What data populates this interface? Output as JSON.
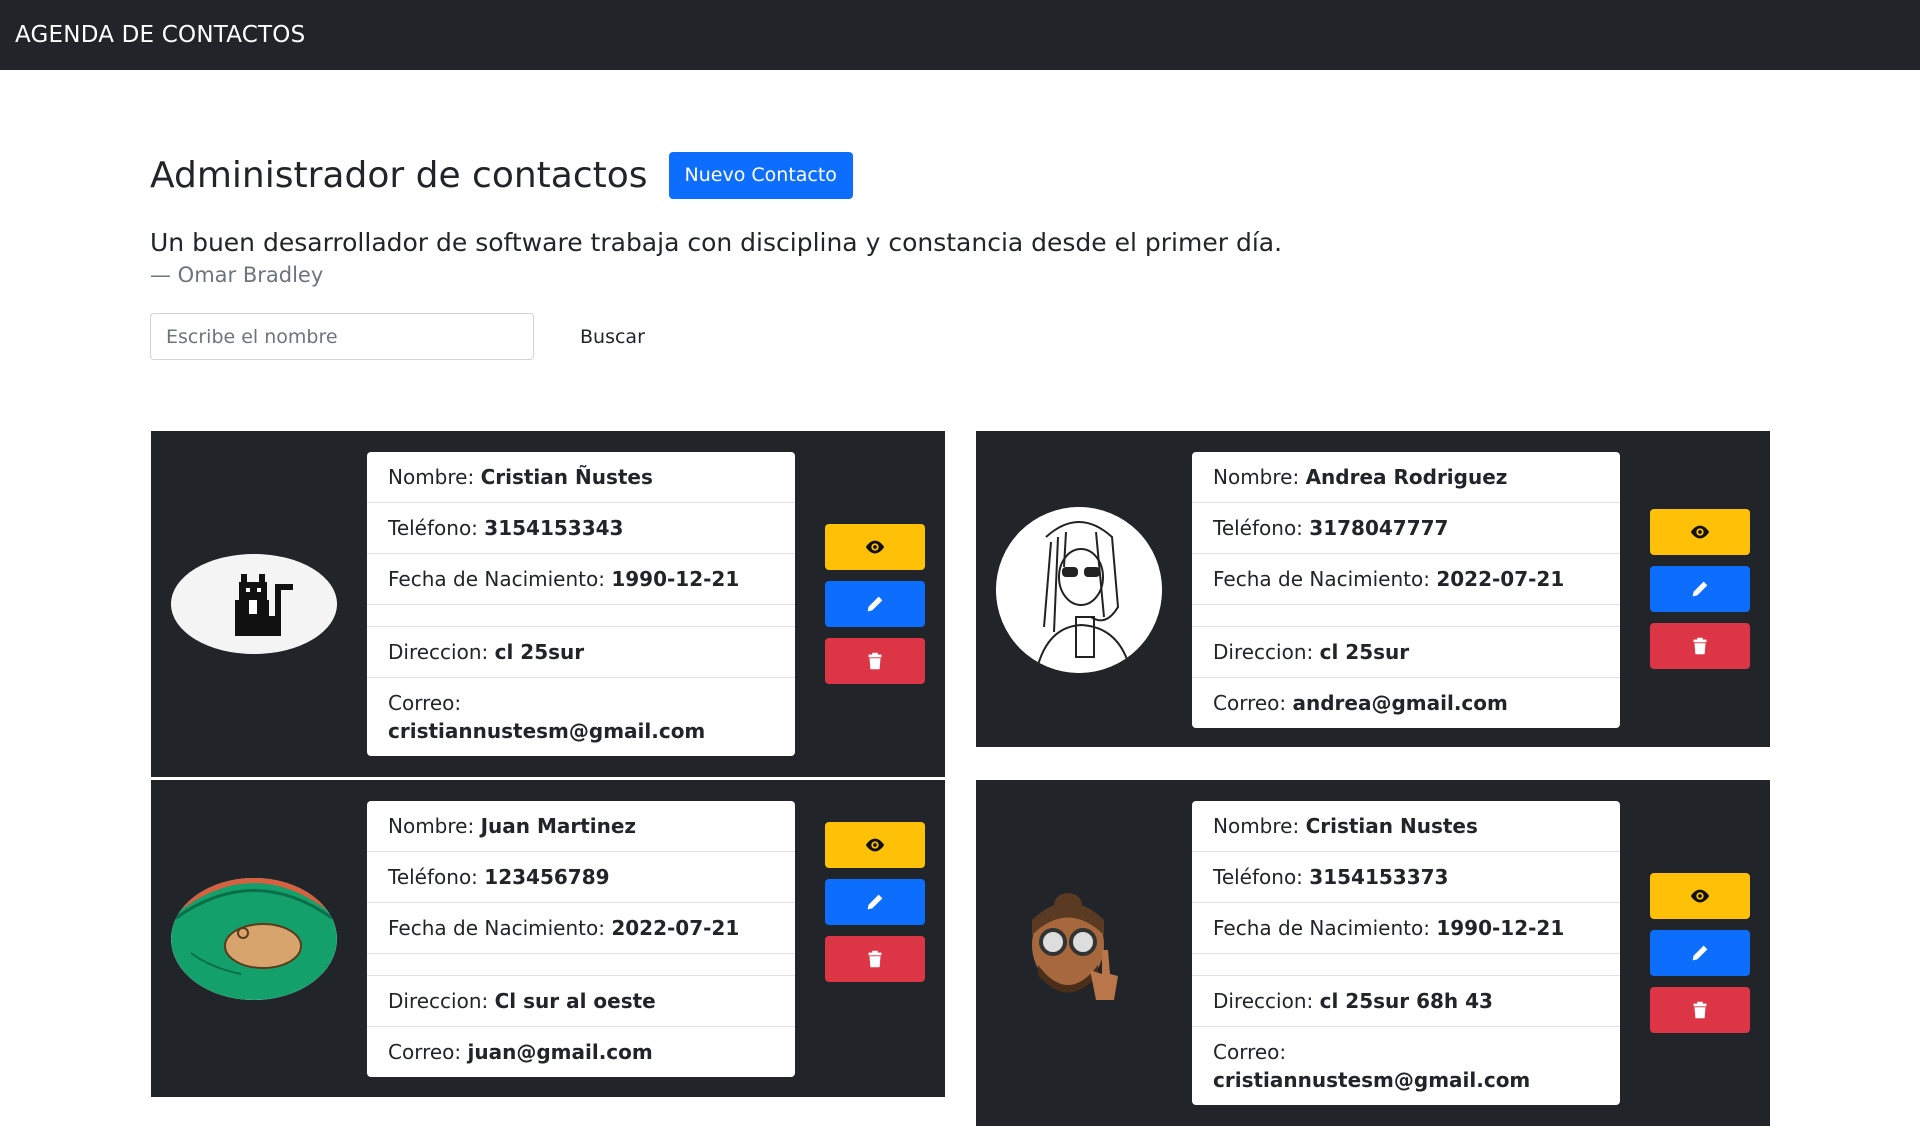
{
  "navbar": {
    "brand": "AGENDA DE CONTACTOS"
  },
  "header": {
    "title": "Administrador de contactos",
    "new_button": "Nuevo Contacto"
  },
  "quote": {
    "text": "Un buen desarrollador de software trabaja con disciplina y constancia desde el primer día.",
    "author": "— Omar Bradley"
  },
  "search": {
    "placeholder": "Escribe el nombre",
    "value": "",
    "button": "Buscar"
  },
  "labels": {
    "name": "Nombre:",
    "phone": "Teléfono:",
    "birth": "Fecha de Nacimiento:",
    "address": "Direccion:",
    "email": "Correo:"
  },
  "contacts": [
    {
      "name": "Cristian Ñustes",
      "phone": "3154153343",
      "birth": "1990-12-21",
      "address": "cl 25sur",
      "email": "cristiannustesm@gmail.com",
      "avatar": "cat-icon"
    },
    {
      "name": "Andrea Rodriguez",
      "phone": "3178047777",
      "birth": "2022-07-21",
      "address": "cl 25sur",
      "email": "andrea@gmail.com",
      "avatar": "girl-sketch-icon"
    },
    {
      "name": "Juan Martinez",
      "phone": "123456789",
      "birth": "2022-07-21",
      "address": "Cl sur al oeste",
      "email": "juan@gmail.com",
      "avatar": "capybara-icon"
    },
    {
      "name": "Cristian Nustes",
      "phone": "3154153373",
      "birth": "1990-12-21",
      "address": "cl 25sur 68h 43",
      "email": "cristiannustesm@gmail.com",
      "avatar": "memoji-icon"
    }
  ],
  "colors": {
    "view": "#ffc107",
    "edit": "#0d6efd",
    "delete": "#dc3545",
    "card": "#212529",
    "navbar": "#212529"
  },
  "action_icons": [
    "eye-icon",
    "pencil-icon",
    "trash-icon"
  ]
}
